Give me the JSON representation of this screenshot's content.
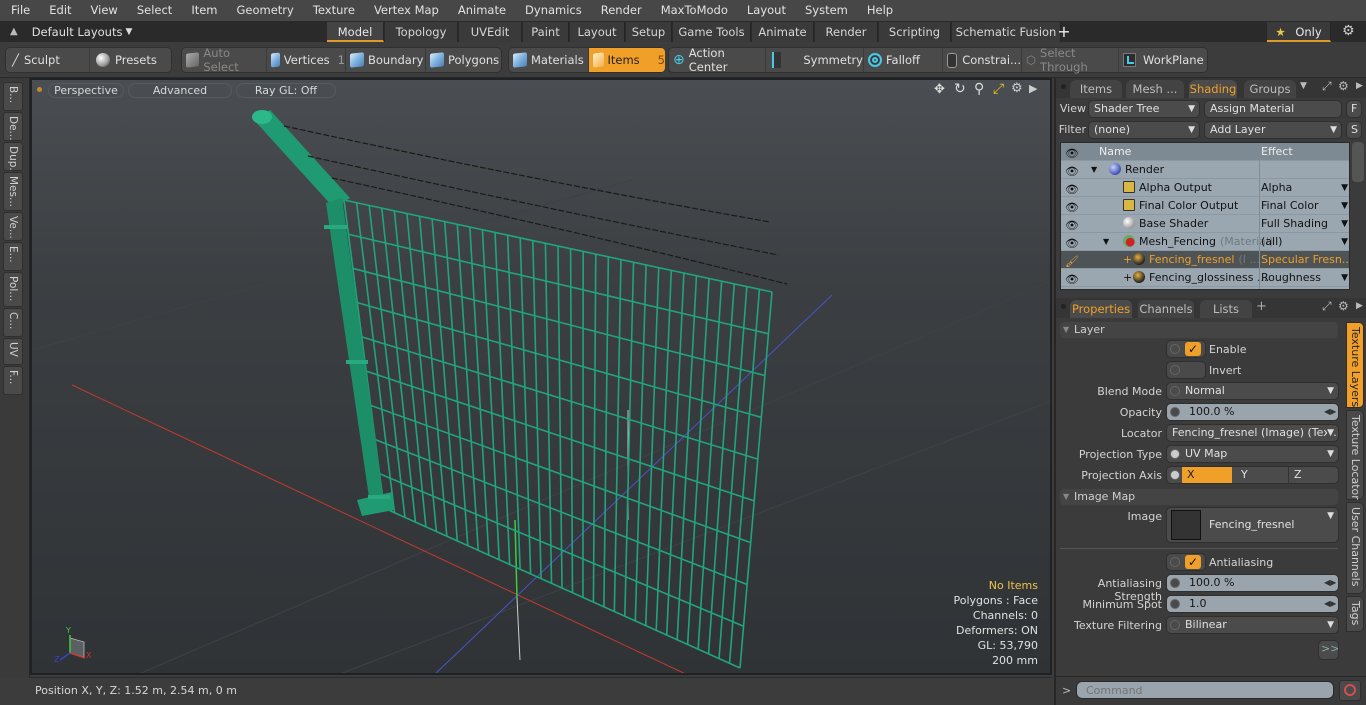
{
  "menubar": [
    "File",
    "Edit",
    "View",
    "Select",
    "Item",
    "Geometry",
    "Texture",
    "Vertex Map",
    "Animate",
    "Dynamics",
    "Render",
    "MaxToModo",
    "Layout",
    "System",
    "Help"
  ],
  "layoutbar": {
    "layouts_label": "Default Layouts",
    "tabs": [
      "Model",
      "Topology",
      "UVEdit",
      "Paint",
      "Layout",
      "Setup",
      "Game Tools",
      "Animate",
      "Render",
      "Scripting",
      "Schematic Fusion"
    ],
    "active_tab": "Model",
    "add_tab": "+",
    "only_label": "Only"
  },
  "toolbar": {
    "sculpt": "Sculpt",
    "presets": "Presets",
    "auto_select": "Auto Select",
    "vertices": "Vertices",
    "vertices_count": "1",
    "boundary": "Boundary",
    "polygons": "Polygons",
    "materials": "Materials",
    "items": "Items",
    "items_count": "5",
    "action_center": "Action Center",
    "symmetry": "Symmetry",
    "falloff": "Falloff",
    "constraints": "Constrai...",
    "select_through": "Select Through",
    "workplane": "WorkPlane"
  },
  "left_tabs": [
    "B...",
    "De...",
    "Dup...",
    "Mes...",
    "Ve...",
    "E...",
    "Pol...",
    "C...",
    "UV",
    "F..."
  ],
  "viewport": {
    "view_mode": "Perspective",
    "shading": "Advanced",
    "raygl": "Ray GL: Off",
    "stats": {
      "selection": "No Items",
      "polygons": "Polygons : Face",
      "channels": "Channels: 0",
      "deformers": "Deformers: ON",
      "gl": "GL: 53,790",
      "grid": "200 mm"
    },
    "axis_labels": {
      "x": "X",
      "y": "Y",
      "z": "Z"
    }
  },
  "statusbar": {
    "position": "Position X, Y, Z:   1.52 m, 2.54 m, 0 m"
  },
  "shader_panel": {
    "tabs": [
      "Items",
      "Mesh ...",
      "Shading",
      "Groups"
    ],
    "active_tab": "Shading",
    "view_label": "View",
    "view_value": "Shader Tree",
    "assign_material": "Assign Material",
    "f_button": "F",
    "filter_label": "Filter",
    "filter_value": "(none)",
    "add_layer": "Add Layer",
    "s_button": "S",
    "columns": {
      "name": "Name",
      "effect": "Effect"
    },
    "rows": [
      {
        "name": "Render",
        "effect": "",
        "icon": "sphere-blue",
        "indent": 0
      },
      {
        "name": "Alpha Output",
        "effect": "Alpha",
        "icon": "output",
        "indent": 1
      },
      {
        "name": "Final Color Output",
        "effect": "Final Color",
        "icon": "output",
        "indent": 1
      },
      {
        "name": "Base Shader",
        "effect": "Full Shading",
        "icon": "sphere-white",
        "indent": 1
      },
      {
        "name": "Mesh_Fencing",
        "suffix": "(Material)",
        "effect": "(all)",
        "icon": "material",
        "indent": 1
      },
      {
        "name": "Fencing_fresnel",
        "suffix": "(I ...",
        "effect": "Specular Fresn...",
        "icon": "image",
        "indent": 2,
        "selected": true
      },
      {
        "name": "Fencing_glossiness ...",
        "effect": "Roughness",
        "icon": "image",
        "indent": 2
      }
    ]
  },
  "properties_panel": {
    "tabs": [
      "Properties",
      "Channels",
      "Lists"
    ],
    "active_tab": "Properties",
    "add_tab": "+",
    "layer_section": "Layer",
    "enable": {
      "label": "Enable",
      "checked": true
    },
    "invert": {
      "label": "Invert",
      "checked": false
    },
    "blend_mode": {
      "label": "Blend Mode",
      "value": "Normal"
    },
    "opacity": {
      "label": "Opacity",
      "value": "100.0 %"
    },
    "locator": {
      "label": "Locator",
      "value": "Fencing_fresnel (Image) (Tex..."
    },
    "projection_type": {
      "label": "Projection Type",
      "value": "UV Map"
    },
    "projection_axis": {
      "label": "Projection Axis",
      "options": [
        "X",
        "Y",
        "Z"
      ],
      "selected": "X"
    },
    "image_map_section": "Image Map",
    "image": {
      "label": "Image",
      "value": "Fencing_fresnel"
    },
    "antialiasing": {
      "label": "Antialiasing",
      "checked": true
    },
    "aa_strength": {
      "label": "Antialiasing Strength",
      "value": "100.0 %"
    },
    "min_spot": {
      "label": "Minimum Spot",
      "value": "1.0"
    },
    "tex_filter": {
      "label": "Texture Filtering",
      "value": "Bilinear"
    },
    "more_button": ">>",
    "side_tabs": [
      "Texture Layers",
      "Texture Locator",
      "User Channels",
      "Tags"
    ],
    "active_side_tab": "Texture Layers"
  },
  "command": {
    "prompt": ">",
    "placeholder": "Command"
  },
  "colors": {
    "accent": "#f0a028",
    "fence_green": "#1e9c74",
    "axis_x": "#d23a2a",
    "axis_y": "#3ac23a",
    "axis_z": "#3446c8"
  }
}
